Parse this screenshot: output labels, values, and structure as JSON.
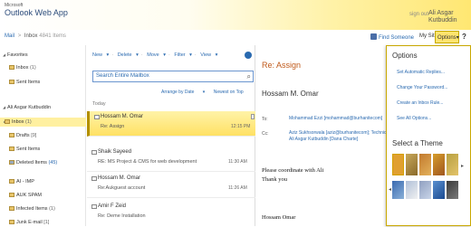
{
  "header": {
    "brand_small": "Microsoft",
    "brand_title": "Outlook Web App",
    "sign_out": "sign out",
    "user_name": "Ali Asgar Kutbuddin"
  },
  "breadcrumb": {
    "root": "Mail",
    "sep": ">",
    "folder": "Inbox",
    "count": "4841 Items"
  },
  "top_links": {
    "find_someone": "Find Someone",
    "my_site": "My Site",
    "options": "Options",
    "options_caret": "▾",
    "help": "?"
  },
  "nav": {
    "favorites_label": "Favorites",
    "favorites": [
      {
        "label": "Inbox",
        "count": "(1)"
      },
      {
        "label": "Sent Items",
        "count": ""
      }
    ],
    "account_label": "Ali Asgar Kutbuddin",
    "folders": [
      {
        "label": "Inbox",
        "count": "(1)"
      },
      {
        "label": "Drafts",
        "count": "[9]"
      },
      {
        "label": "Sent Items",
        "count": ""
      },
      {
        "label": "Deleted Items",
        "count": "(45)"
      },
      {
        "label": "AI - IMP",
        "count": ""
      },
      {
        "label": "AUK SPAM",
        "count": ""
      },
      {
        "label": "Infected Items",
        "count": "(1)"
      },
      {
        "label": "Junk E-mail",
        "count": "[1]"
      }
    ]
  },
  "toolbar": {
    "new": "New",
    "delete": "Delete",
    "move": "Move",
    "filter": "Filter",
    "view": "View",
    "sep": "·"
  },
  "search": {
    "placeholder": "Search Entire Mailbox",
    "icon": "search-icon"
  },
  "arrange": {
    "by": "Arrange by Date",
    "order": "Newest on Top"
  },
  "list": {
    "group_label": "Today",
    "messages": [
      {
        "from": "Hossam M. Omar",
        "subject": "Re: Assign",
        "time": "12:15 PM",
        "selected": true
      },
      {
        "from": "Shaik Sayeed",
        "subject": "RE: MS Project & CMS for web development",
        "time": "11:30 AM",
        "selected": false
      },
      {
        "from": "Hossam M. Omar",
        "subject": "Re:Aukguest account",
        "time": "11:26 AM",
        "selected": false
      },
      {
        "from": "Amir F Zeid",
        "subject": "Re: Deme Installation",
        "time": "",
        "selected": false
      }
    ]
  },
  "reading": {
    "subject": "Re: Assign",
    "from": "Hossam M. Omar",
    "to_label": "To:",
    "to_value": "Mohammad Ezzi [mohammad@burhanitecom]",
    "cc_label": "Cc:",
    "cc_line1": "Aziz Sukhsorwala [aziz@burhanitecom]; Technical Coordin",
    "cc_line2": "Ali Asgar Kutbuddin [Dana Charte]",
    "sent_time": "12:15 PM",
    "body_line1": "Please coordinate with Ali",
    "body_line2": "Thank you",
    "signature": "Hossam Omar"
  },
  "options_menu": {
    "title": "Options",
    "links": [
      "Set Automatic Replies...",
      "Change Your Password...",
      "Create an Inbox Rule...",
      "See All Options..."
    ],
    "theme_title": "Select a Theme"
  },
  "colors": {
    "accent_yellow": "#ffe164",
    "link_blue": "#2a6ab0",
    "subject_orange": "#c05a1b"
  }
}
